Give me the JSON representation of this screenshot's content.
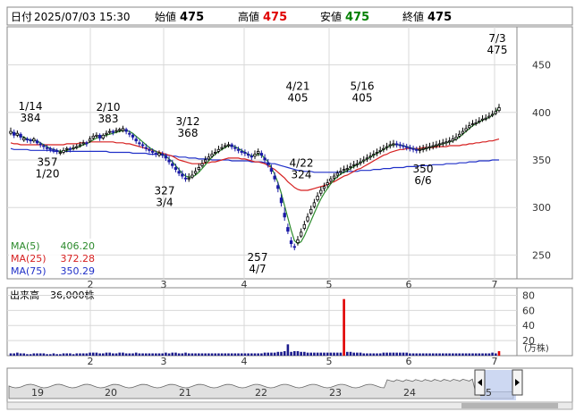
{
  "header": {
    "datetime_label": "日付",
    "datetime": "2025/07/03 15:30",
    "open_label": "始値",
    "open": "475",
    "high_label": "高値",
    "high": "475",
    "low_label": "安値",
    "low": "475",
    "close_label": "終値",
    "close": "475"
  },
  "colors": {
    "up": "#000000",
    "down": "#1a1aa6",
    "high": "#e00000",
    "low": "#008000",
    "ma5": "#2c8a2c",
    "ma25": "#d62020",
    "ma75": "#2030c8",
    "volume": "#1a1a8c",
    "volume_spike": "#e00000",
    "frame": "#888888",
    "grid": "#d8d8d8"
  },
  "legend": {
    "ma5_label": "MA(5)",
    "ma5": "406.20",
    "ma25_label": "MA(25)",
    "ma25": "372.28",
    "ma75_label": "MA(75)",
    "ma75": "350.29"
  },
  "volume_panel": {
    "title": "出来高",
    "scale": "36,000株",
    "unit": "(万株)",
    "ticks": [
      "80",
      "60",
      "40",
      "20"
    ]
  },
  "chart_data": [
    {
      "type": "candlestick",
      "ylim": [
        225,
        490
      ],
      "yticks": [
        "450",
        "400",
        "350",
        "300",
        "250"
      ],
      "xticks": [
        "2",
        "3",
        "4",
        "5",
        "6",
        "7"
      ],
      "annotations": [
        {
          "label": "1/14",
          "value": "384"
        },
        {
          "label": "1/20",
          "value": "357"
        },
        {
          "label": "2/10",
          "value": "383"
        },
        {
          "label": "3/4",
          "value": "327"
        },
        {
          "label": "3/12",
          "value": "368"
        },
        {
          "label": "4/7",
          "value": "257"
        },
        {
          "label": "4/21",
          "value": "405"
        },
        {
          "label": "4/22",
          "value": "324"
        },
        {
          "label": "5/16",
          "value": "405"
        },
        {
          "label": "6/6",
          "value": "350"
        },
        {
          "label": "7/3",
          "value": "475"
        }
      ],
      "close": [
        380,
        376,
        378,
        374,
        373,
        371,
        370,
        372,
        368,
        366,
        364,
        362,
        361,
        360,
        359,
        358,
        360,
        362,
        361,
        363,
        364,
        366,
        368,
        367,
        372,
        375,
        376,
        373,
        376,
        378,
        380,
        379,
        381,
        382,
        383,
        380,
        377,
        374,
        370,
        367,
        365,
        362,
        360,
        358,
        356,
        357,
        355,
        352,
        348,
        344,
        340,
        336,
        333,
        330,
        331,
        334,
        338,
        342,
        346,
        350,
        353,
        356,
        358,
        361,
        363,
        365,
        366,
        364,
        362,
        360,
        358,
        357,
        355,
        353,
        356,
        359,
        355,
        350,
        345,
        338,
        330,
        320,
        305,
        290,
        275,
        262,
        258,
        266,
        274,
        282,
        290,
        298,
        305,
        312,
        318,
        322,
        326,
        330,
        333,
        336,
        338,
        340,
        341,
        343,
        345,
        346,
        348,
        350,
        352,
        354,
        356,
        358,
        360,
        362,
        364,
        366,
        367,
        366,
        365,
        364,
        363,
        362,
        361,
        360,
        361,
        362,
        363,
        364,
        365,
        366,
        367,
        368,
        369,
        370,
        372,
        374,
        377,
        380,
        383,
        386,
        388,
        389,
        391,
        393,
        394,
        396,
        398,
        401,
        405
      ],
      "open": [
        378,
        379,
        376,
        377,
        371,
        372,
        371,
        370,
        370,
        367,
        365,
        363,
        362,
        361,
        360,
        357,
        358,
        361,
        362,
        362,
        363,
        365,
        367,
        368,
        370,
        373,
        375,
        376,
        373,
        377,
        379,
        380,
        380,
        381,
        381,
        382,
        378,
        376,
        372,
        368,
        366,
        363,
        361,
        359,
        357,
        355,
        356,
        354,
        350,
        346,
        342,
        338,
        335,
        331,
        330,
        332,
        336,
        340,
        344,
        348,
        351,
        354,
        357,
        359,
        362,
        364,
        365,
        366,
        363,
        361,
        359,
        358,
        356,
        354,
        354,
        357,
        357,
        352,
        347,
        341,
        333,
        323,
        310,
        294,
        279,
        265,
        259,
        263,
        270,
        278,
        286,
        294,
        301,
        308,
        315,
        320,
        324,
        328,
        331,
        334,
        337,
        339,
        340,
        342,
        344,
        345,
        347,
        349,
        351,
        353,
        355,
        357,
        359,
        361,
        363,
        365,
        366,
        367,
        366,
        365,
        364,
        363,
        362,
        361,
        360,
        361,
        362,
        363,
        364,
        365,
        366,
        367,
        368,
        369,
        370,
        372,
        375,
        378,
        381,
        384,
        387,
        388,
        390,
        392,
        393,
        395,
        397,
        399,
        402
      ],
      "high": [
        384,
        382,
        381,
        379,
        375,
        374,
        373,
        374,
        372,
        369,
        367,
        366,
        364,
        363,
        362,
        361,
        363,
        364,
        364,
        366,
        367,
        369,
        371,
        370,
        375,
        378,
        379,
        378,
        378,
        381,
        383,
        382,
        384,
        384,
        386,
        384,
        381,
        378,
        375,
        371,
        369,
        367,
        364,
        362,
        360,
        360,
        359,
        357,
        354,
        350,
        346,
        342,
        339,
        336,
        336,
        339,
        342,
        346,
        350,
        354,
        357,
        360,
        362,
        365,
        367,
        368,
        369,
        368,
        366,
        364,
        362,
        361,
        359,
        357,
        360,
        362,
        360,
        356,
        351,
        345,
        337,
        327,
        314,
        300,
        283,
        269,
        262,
        270,
        278,
        286,
        294,
        302,
        309,
        316,
        322,
        326,
        330,
        333,
        336,
        339,
        342,
        344,
        345,
        347,
        349,
        350,
        352,
        354,
        356,
        358,
        360,
        362,
        364,
        366,
        368,
        370,
        371,
        370,
        369,
        368,
        367,
        366,
        365,
        364,
        365,
        366,
        367,
        368,
        369,
        370,
        371,
        372,
        373,
        374,
        376,
        378,
        381,
        384,
        387,
        390,
        392,
        393,
        395,
        397,
        398,
        400,
        402,
        405,
        409
      ],
      "low": [
        376,
        373,
        374,
        371,
        369,
        368,
        367,
        368,
        366,
        363,
        361,
        359,
        358,
        357,
        356,
        355,
        356,
        358,
        358,
        360,
        361,
        363,
        365,
        364,
        368,
        371,
        373,
        370,
        371,
        374,
        377,
        376,
        378,
        379,
        379,
        377,
        374,
        371,
        367,
        364,
        362,
        359,
        357,
        355,
        353,
        353,
        352,
        349,
        345,
        341,
        337,
        333,
        330,
        327,
        327,
        330,
        334,
        338,
        342,
        346,
        349,
        352,
        355,
        357,
        360,
        362,
        363,
        361,
        359,
        357,
        355,
        354,
        352,
        350,
        351,
        354,
        352,
        347,
        342,
        335,
        327,
        316,
        301,
        286,
        272,
        258,
        255,
        260,
        268,
        276,
        284,
        292,
        299,
        306,
        312,
        317,
        321,
        325,
        328,
        331,
        334,
        336,
        337,
        339,
        341,
        342,
        344,
        346,
        348,
        350,
        352,
        354,
        356,
        358,
        360,
        362,
        363,
        363,
        362,
        361,
        360,
        359,
        358,
        357,
        357,
        358,
        359,
        360,
        361,
        362,
        363,
        364,
        365,
        366,
        368,
        370,
        373,
        376,
        379,
        382,
        385,
        386,
        388,
        390,
        391,
        393,
        395,
        397,
        400
      ],
      "ma5": [
        380,
        378,
        377,
        375,
        374,
        372,
        371,
        371,
        370,
        368,
        366,
        364,
        362,
        361,
        360,
        359,
        359,
        360,
        361,
        362,
        363,
        364,
        366,
        367,
        369,
        371,
        373,
        374,
        375,
        376,
        377,
        378,
        379,
        380,
        381,
        381,
        380,
        378,
        375,
        372,
        369,
        366,
        363,
        361,
        359,
        357,
        356,
        354,
        351,
        348,
        344,
        340,
        336,
        333,
        332,
        332,
        334,
        337,
        341,
        345,
        349,
        353,
        356,
        359,
        361,
        363,
        365,
        365,
        364,
        362,
        360,
        358,
        356,
        354,
        355,
        356,
        355,
        352,
        348,
        342,
        335,
        326,
        315,
        302,
        289,
        276,
        265,
        262,
        264,
        270,
        278,
        286,
        294,
        302,
        309,
        315,
        320,
        325,
        329,
        332,
        335,
        337,
        339,
        341,
        343,
        345,
        347,
        349,
        351,
        353,
        355,
        357,
        359,
        361,
        363,
        365,
        366,
        366,
        366,
        365,
        364,
        363,
        362,
        361,
        361,
        361,
        362,
        363,
        364,
        365,
        366,
        367,
        368,
        369,
        370,
        372,
        374,
        377,
        380,
        383,
        386,
        388,
        390,
        392,
        393,
        395,
        397,
        400,
        406
      ],
      "ma25": [
        368,
        367,
        367,
        366,
        366,
        366,
        366,
        366,
        366,
        366,
        366,
        366,
        366,
        366,
        366,
        366,
        366,
        367,
        367,
        367,
        367,
        368,
        368,
        368,
        369,
        369,
        369,
        369,
        369,
        369,
        369,
        369,
        368,
        368,
        368,
        367,
        367,
        366,
        365,
        364,
        363,
        362,
        361,
        360,
        359,
        358,
        357,
        356,
        355,
        354,
        352,
        350,
        349,
        348,
        347,
        346,
        346,
        346,
        346,
        347,
        347,
        348,
        348,
        349,
        350,
        351,
        352,
        352,
        352,
        352,
        351,
        351,
        350,
        349,
        348,
        348,
        347,
        346,
        344,
        342,
        340,
        337,
        334,
        331,
        327,
        324,
        321,
        319,
        318,
        318,
        318,
        319,
        320,
        321,
        322,
        323,
        324,
        326,
        327,
        329,
        331,
        333,
        334,
        336,
        338,
        340,
        341,
        343,
        345,
        347,
        349,
        351,
        353,
        355,
        356,
        358,
        359,
        360,
        361,
        361,
        362,
        362,
        362,
        362,
        362,
        363,
        363,
        363,
        363,
        364,
        364,
        364,
        364,
        365,
        365,
        365,
        365,
        366,
        366,
        367,
        367,
        368,
        368,
        369,
        369,
        370,
        370,
        371,
        372
      ],
      "ma75": [
        362,
        361,
        361,
        361,
        361,
        361,
        360,
        360,
        360,
        360,
        360,
        360,
        360,
        359,
        359,
        359,
        359,
        359,
        359,
        359,
        359,
        359,
        359,
        359,
        359,
        359,
        359,
        359,
        359,
        359,
        358,
        358,
        358,
        358,
        358,
        358,
        358,
        357,
        357,
        357,
        357,
        357,
        356,
        356,
        356,
        356,
        355,
        355,
        355,
        354,
        354,
        353,
        353,
        353,
        352,
        352,
        352,
        351,
        351,
        351,
        351,
        350,
        350,
        350,
        350,
        350,
        350,
        349,
        349,
        349,
        349,
        349,
        349,
        348,
        348,
        348,
        348,
        347,
        347,
        346,
        346,
        345,
        344,
        343,
        342,
        341,
        340,
        339,
        339,
        338,
        338,
        338,
        337,
        337,
        337,
        337,
        337,
        337,
        337,
        337,
        337,
        337,
        338,
        338,
        338,
        338,
        339,
        339,
        339,
        339,
        340,
        340,
        340,
        341,
        341,
        341,
        342,
        342,
        342,
        342,
        343,
        343,
        343,
        343,
        344,
        344,
        344,
        344,
        345,
        345,
        345,
        345,
        346,
        346,
        346,
        346,
        347,
        347,
        347,
        348,
        348,
        348,
        349,
        349,
        349,
        349,
        350,
        350,
        350
      ],
      "volume": [
        3,
        3,
        4,
        3,
        3,
        2,
        2,
        3,
        3,
        3,
        3,
        2,
        2,
        3,
        2,
        2,
        3,
        3,
        3,
        2,
        3,
        3,
        3,
        3,
        4,
        4,
        4,
        3,
        3,
        4,
        4,
        3,
        3,
        4,
        4,
        3,
        3,
        3,
        4,
        3,
        3,
        3,
        3,
        3,
        3,
        3,
        3,
        4,
        3,
        4,
        4,
        3,
        3,
        4,
        3,
        3,
        3,
        3,
        3,
        3,
        3,
        3,
        3,
        3,
        3,
        3,
        3,
        3,
        3,
        3,
        3,
        3,
        3,
        3,
        3,
        3,
        3,
        4,
        4,
        4,
        4,
        5,
        5,
        6,
        15,
        5,
        6,
        6,
        5,
        5,
        4,
        4,
        4,
        4,
        4,
        4,
        4,
        4,
        4,
        4,
        4,
        75,
        5,
        5,
        4,
        4,
        4,
        3,
        3,
        3,
        3,
        3,
        3,
        4,
        4,
        4,
        4,
        4,
        4,
        4,
        4,
        3,
        3,
        3,
        3,
        3,
        3,
        3,
        3,
        3,
        3,
        3,
        3,
        3,
        3,
        3,
        3,
        3,
        3,
        3,
        3,
        3,
        3,
        3,
        3,
        3,
        4,
        3,
        6
      ]
    },
    {
      "type": "area",
      "xticks": [
        "19",
        "20",
        "21",
        "22",
        "23",
        "24",
        "25"
      ]
    }
  ]
}
